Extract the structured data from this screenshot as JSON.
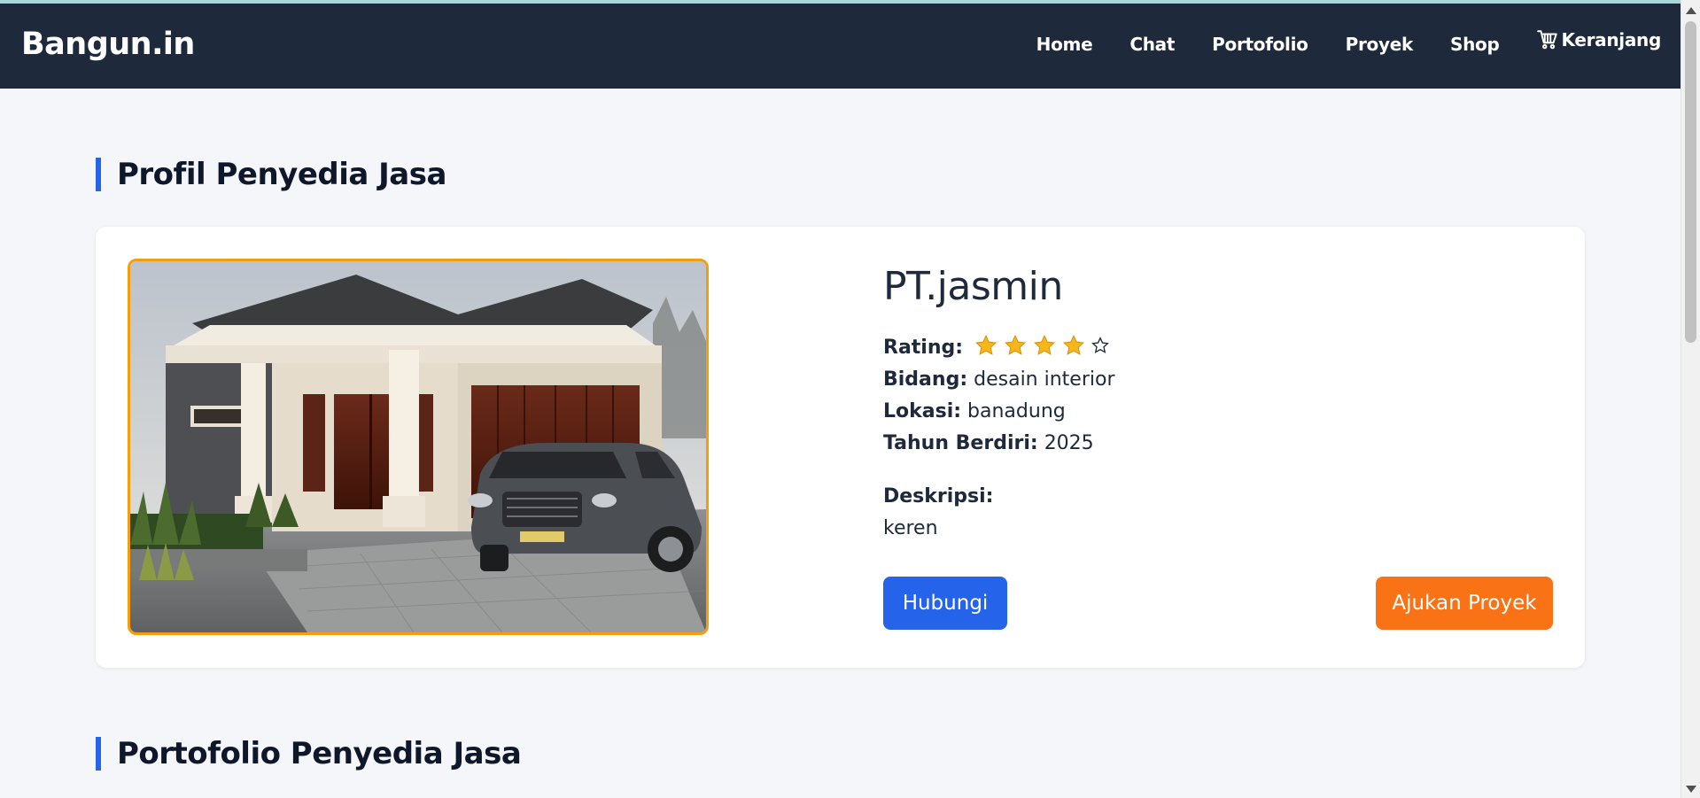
{
  "navbar": {
    "brand": "Bangun.in",
    "links": [
      "Home",
      "Chat",
      "Portofolio",
      "Proyek",
      "Shop"
    ],
    "cart_label": "Keranjang",
    "cart_icon": "cart-icon"
  },
  "profile": {
    "heading": "Profil Penyedia Jasa",
    "image_icon": "house-photo",
    "company_name": "PT.jasmin",
    "rating_label": "Rating:",
    "rating_value": 4,
    "rating_max": 5,
    "field_label": "Bidang:",
    "field_value": "desain interior",
    "location_label": "Lokasi:",
    "location_value": "banadung",
    "year_label": "Tahun Berdiri:",
    "year_value": "2025",
    "description_label": "Deskripsi:",
    "description_value": "keren",
    "contact_button": "Hubungi",
    "propose_button": "Ajukan Proyek"
  },
  "portfolio": {
    "heading": "Portofolio Penyedia Jasa"
  },
  "colors": {
    "navbar_bg": "#1e293b",
    "accent_blue": "#2563eb",
    "accent_orange": "#f97316",
    "star_gold": "#f6b71a",
    "image_border": "#f59e0b"
  }
}
